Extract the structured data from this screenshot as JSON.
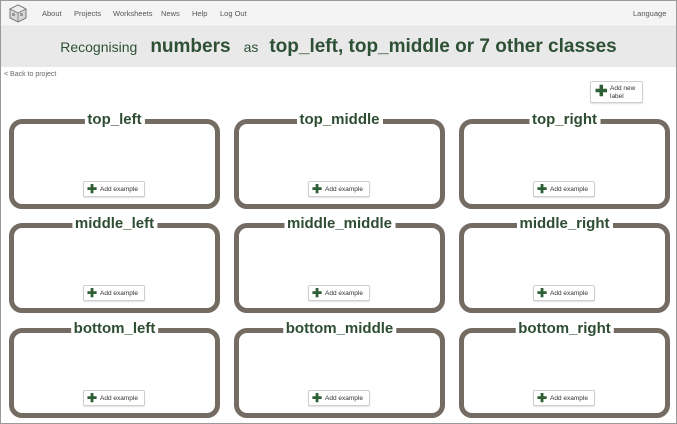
{
  "nav": {
    "about": "About",
    "projects": "Projects",
    "worksheets": "Worksheets",
    "news": "News",
    "help": "Help",
    "logout": "Log Out",
    "language": "Language"
  },
  "banner": {
    "prefix": "Recognising",
    "type": "numbers",
    "as": "as",
    "classes": "top_left, top_middle or 7 other classes"
  },
  "back_link": "< Back to project",
  "add_label": "Add new label",
  "add_example_label": "Add example",
  "labels": [
    "top_left",
    "top_middle",
    "top_right",
    "middle_left",
    "middle_middle",
    "middle_right",
    "bottom_left",
    "bottom_middle",
    "bottom_right"
  ],
  "colors": {
    "accent_green": "#2e5136",
    "card_border": "#746c62",
    "banner_bg": "#e9e9e9"
  }
}
